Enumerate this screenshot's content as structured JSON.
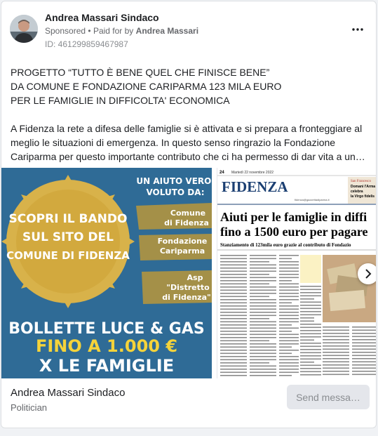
{
  "post": {
    "poster_name": "Andrea Massari Sindaco",
    "sponsored": "Sponsored",
    "paid_prefix": "Paid for by",
    "paid_by": "Andrea Massari",
    "id": "ID: 461299859467987",
    "more_icon": "more-horizontal-icon"
  },
  "text": {
    "title_line1": "PROGETTO “TUTTO È BENE QUEL CHE FINISCE BENE”",
    "title_line2": "DA COMUNE E FONDAZIONE CARIPARMA 123 MILA EURO",
    "title_line3": "PER LE FAMIGLIE IN DIFFICOLTA' ECONOMICA",
    "body": "A Fidenza la rete a difesa delle famiglie si è attivata e si prepara a fronteggiare al meglio le situazioni di emergenza. In questo senso ringrazio la Fondazione Cariparma per questo importante contributo che ci ha permesso di dar vita a un…"
  },
  "ad_image": {
    "badge_line1": "SCOPRI IL BANDO",
    "badge_line2": "SUL SITO DEL",
    "badge_line3": "COMUNE DI FIDENZA",
    "aiuto_line1": "UN AIUTO VERO.",
    "aiuto_line2": "VOLUTO DA:",
    "partner1_line1": "Comune",
    "partner1_line2": "di Fidenza",
    "partner2_line1": "Fondazione",
    "partner2_line2": "Cariparma",
    "partner3_line1": "Asp",
    "partner3_line2": "\"Distretto",
    "partner3_line3": "di Fidenza\"",
    "bottom_line1": "BOLLETTE LUCE & GAS",
    "bottom_line2": "FINO A 1.000 €",
    "bottom_line3": "X LE FAMIGLIE",
    "colors": {
      "blue": "#2f6b96",
      "gold": "#d8b24a",
      "yellow": "#f5d33a",
      "white": "#ffffff"
    }
  },
  "newspaper": {
    "page_num": "24",
    "date": "Martedì 22 novembre 2022",
    "masthead": "FIDENZA",
    "side_line1": "San Francesco",
    "side_line2": "Domani l'Arma",
    "side_line3": "celebra",
    "side_line4": "la Virgo fidelis",
    "email": "fidenza@gazzettadiparma.it",
    "headline_line1": "Aiuti per le famiglie in diffi",
    "headline_line2": "fino a 1500 euro per pagare",
    "subhead": "Stanziamento di 123mila euro grazie al contributo di Fondazio"
  },
  "footer": {
    "name": "Andrea Massari Sindaco",
    "role": "Politician",
    "send_label": "Send messa…"
  }
}
